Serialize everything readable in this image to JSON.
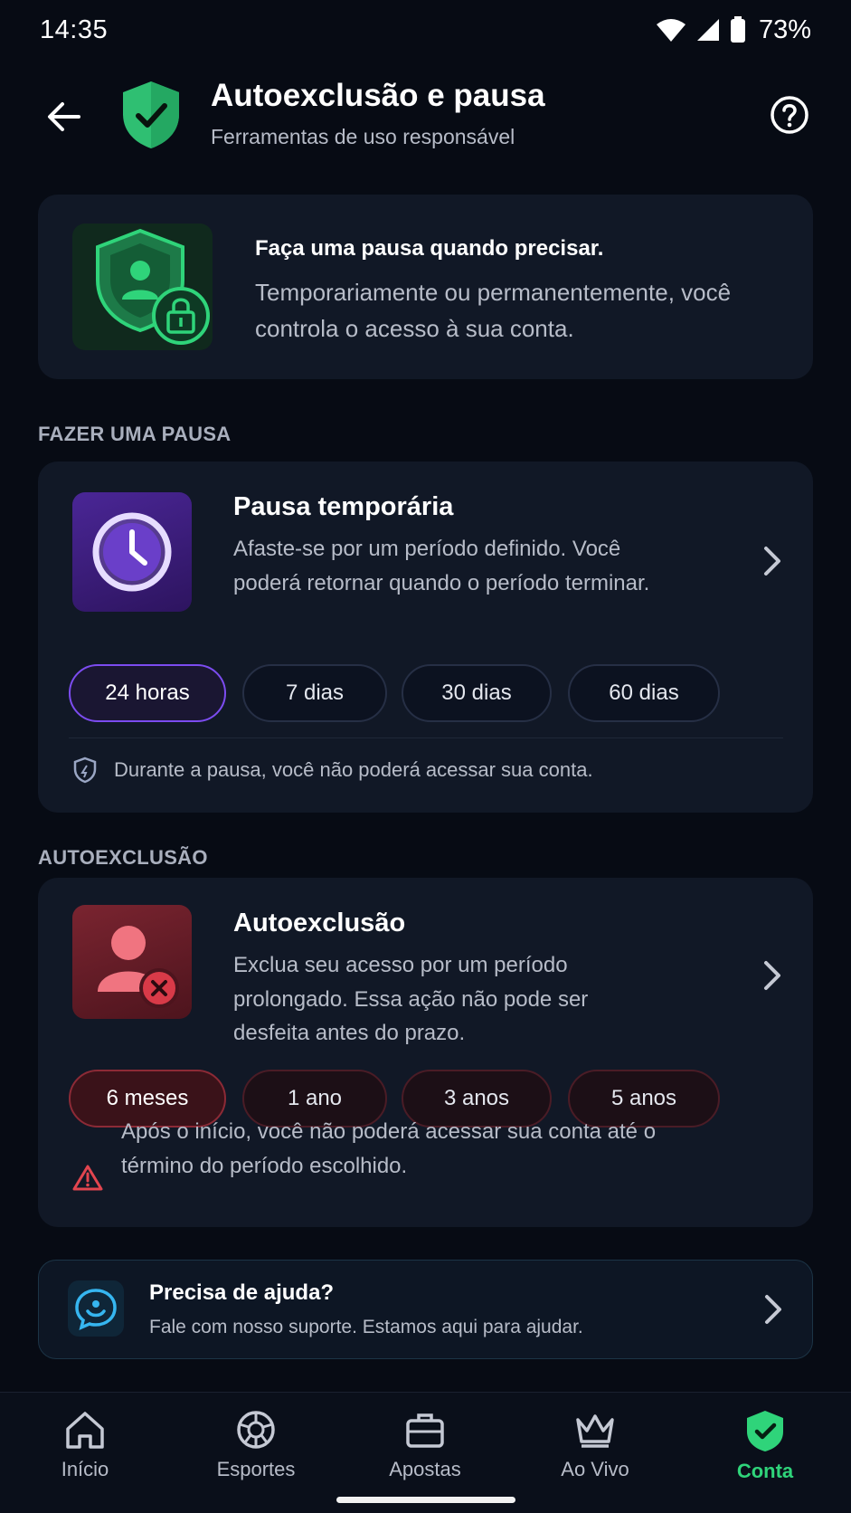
{
  "status_bar": {
    "time": "14:35",
    "battery": "73%"
  },
  "header": {
    "title": "Autoexclusão e pausa",
    "subtitle": "Ferramentas de uso responsável",
    "back_icon": "arrow-left-icon",
    "help_icon": "question-circle-icon"
  },
  "intro": {
    "title": "Faça uma pausa quando precisar.",
    "text": "Temporariamente ou permanentemente, você controla o acesso à sua conta."
  },
  "pause_section": {
    "label": "FAZER UMA PAUSA",
    "title": "Pausa temporária",
    "description": "Afaste-se por um período definido. Você poderá retornar quando o período terminar.",
    "options": [
      {
        "label": "24 horas",
        "selected": true
      },
      {
        "label": "7 dias",
        "selected": false
      },
      {
        "label": "30 dias",
        "selected": false
      },
      {
        "label": "60 dias",
        "selected": false
      }
    ],
    "note": "Durante a pausa, você não poderá acessar sua conta."
  },
  "exclusion_section": {
    "label": "AUTOEXCLUSÃO",
    "title": "Autoexclusão",
    "description": "Exclua seu acesso por um período prolongado. Essa ação não pode ser desfeita antes do prazo.",
    "options": [
      {
        "label": "6 meses",
        "selected": true
      },
      {
        "label": "1 ano",
        "selected": false
      },
      {
        "label": "3 anos",
        "selected": false
      },
      {
        "label": "5 anos",
        "selected": false
      }
    ],
    "warning": "Após o início, você não poderá acessar sua conta até o término do período escolhido."
  },
  "help": {
    "title": "Precisa de ajuda?",
    "text": "Fale com nosso suporte. Estamos aqui para ajudar."
  },
  "bottom_nav": [
    {
      "label": "Início",
      "icon": "home-icon",
      "active": false
    },
    {
      "label": "Esportes",
      "icon": "ball-icon",
      "active": false
    },
    {
      "label": "Apostas",
      "icon": "briefcase-icon",
      "active": false
    },
    {
      "label": "Ao Vivo",
      "icon": "crown-icon",
      "active": false
    },
    {
      "label": "Conta",
      "icon": "shield-check-icon",
      "active": true
    }
  ],
  "colors": {
    "background": "#070b14",
    "accent_green": "#2fd47a",
    "pause_purple": "#7c4cf0",
    "exclusion_red": "#d83a48"
  }
}
